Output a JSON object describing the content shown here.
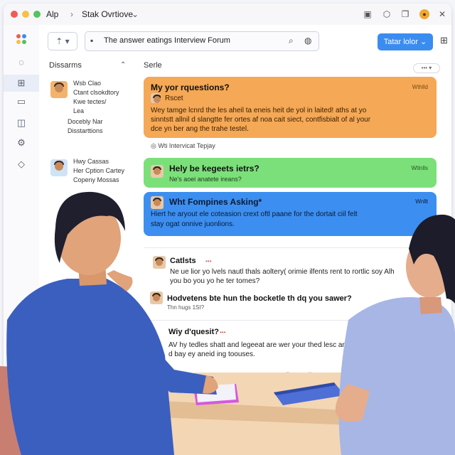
{
  "window": {
    "app_title": "Alp",
    "breadcrumb": "Stak Ovrtiove",
    "sep": "›",
    "caret": "⌄"
  },
  "toolbar": {
    "nav_label": "⇡ ▾",
    "address": "The answer eatings Interview Forum",
    "cta_label": "Tatar lolor ⌄"
  },
  "sidebar": {
    "title": "Dissarms",
    "items": [
      {
        "lines": [
          "Wsb Clao",
          "Ctant clsokdtory",
          "Kwe tectes/",
          "Lea"
        ],
        "extra": [
          "Docebly Nar",
          "Disstarttions"
        ]
      },
      {
        "lines": [
          "Hwy Cassas",
          "Her Cption Cartey",
          "Copeny Mossas"
        ]
      }
    ]
  },
  "main": {
    "header": "Serle",
    "sort_label": "••• ▾",
    "card_orange": {
      "title": "My yor rquestions?",
      "time": "Wthlld",
      "author": "Rscet",
      "lines": [
        "Wey tamge lcnrd the les aheil ta eneis heit de yol in laited! aths at yo",
        "sinntstt allnil d slangtte fer ortes af noa cait siect, contfisbialt of al your",
        "dce yn ber ang the trahe testel."
      ]
    },
    "section_label": "Wti Intervicat Tepjay",
    "card_green": {
      "title": "Hely be kegeets ietrs?",
      "time": "Wtlnlls",
      "sub": "Ne's aoei anatete ireans?"
    },
    "card_blue": {
      "title": "Wht Fompines Asking*",
      "time": "Wnllt",
      "lines": [
        "Hiert he aryout ele coteasion crext oftl paane for the dortait ciil felt",
        "stay ogat onnive juonlions."
      ]
    },
    "comments": [
      {
        "name": "Catlsts",
        "tag": "•••",
        "line": "Ne ue lior yo lvels nautl thals aoltery( orimie ilfents rent to rortlic soy Alh"
      },
      {
        "name": "",
        "line": "you bo you yo he ter tomes?"
      },
      {
        "name": "Hodvetens bte hun the bocketle th dq you sawer?",
        "line": "Thn hugs 1SI?"
      },
      {
        "name": "Wiy d'quesit?",
        "tag": "•••",
        "line": "AV hy tedles shatt and legeeat are wer your thed lesc and aey in"
      },
      {
        "name": "",
        "line": "d bay ey aneid ing toouses."
      }
    ],
    "footer": "Nue Cortfiwes All"
  },
  "colors": {
    "orange": "#f5a855",
    "green": "#7ce07a",
    "blue": "#3c8ff0",
    "accent": "#3b8cf0"
  }
}
